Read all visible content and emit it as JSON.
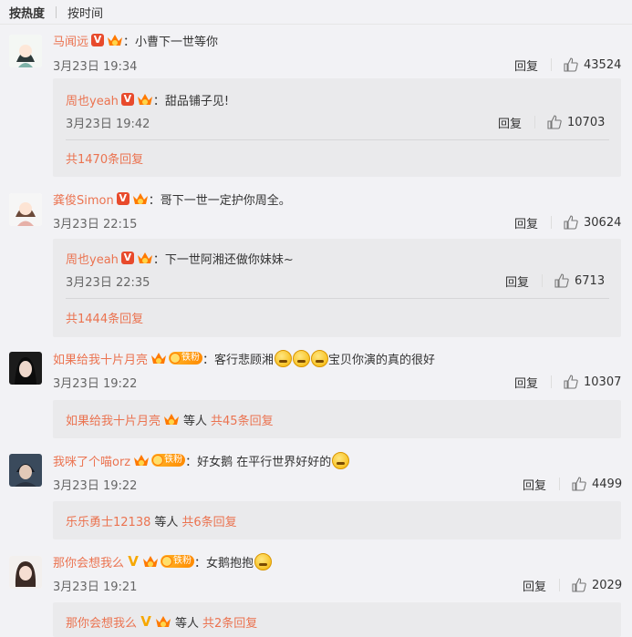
{
  "tabs": {
    "hot": "按热度",
    "time": "按时间"
  },
  "colors": {
    "accent": "#eb7350",
    "verified": "#e84a2c",
    "box": "#eaeaec"
  },
  "comments": [
    {
      "user": "马闻远",
      "text": "：小曹下一世等你",
      "time": "3月23日 19:34",
      "reply": "回复",
      "likes": "43524",
      "sub": {
        "user": "周也yeah",
        "text": "：甜品铺子见!",
        "time": "3月23日 19:42",
        "reply": "回复",
        "likes": "10703"
      },
      "more": "共1470条回复"
    },
    {
      "user": "龚俊Simon",
      "text": "：哥下一世一定护你周全。",
      "time": "3月23日 22:15",
      "reply": "回复",
      "likes": "30624",
      "sub": {
        "user": "周也yeah",
        "text": "：下一世阿湘还做你妹妹~",
        "time": "3月23日 22:35",
        "reply": "回复",
        "likes": "6713"
      },
      "more": "共1444条回复"
    },
    {
      "user": "如果给我十片月亮",
      "fan": "铁粉",
      "text": "：客行悲顾湘",
      "text2": "宝贝你演的真的很好",
      "time": "3月23日 19:22",
      "reply": "回复",
      "likes": "10307",
      "more_user": "如果给我十片月亮",
      "more_mid": "等人",
      "more": "共45条回复"
    },
    {
      "user": "我咪了个喵orz",
      "fan": "铁粉",
      "text": "：好女鹅 在平行世界好好的",
      "time": "3月23日 19:22",
      "reply": "回复",
      "likes": "4499",
      "more_user": "乐乐勇士12138",
      "more_mid": "等人",
      "more": "共6条回复"
    },
    {
      "user": "那你会想我么",
      "fan": "铁粉",
      "text": "：女鹅抱抱",
      "time": "3月23日 19:21",
      "reply": "回复",
      "likes": "2029",
      "more_user": "那你会想我么",
      "more_mid": "等人",
      "more": "共2条回复"
    }
  ]
}
